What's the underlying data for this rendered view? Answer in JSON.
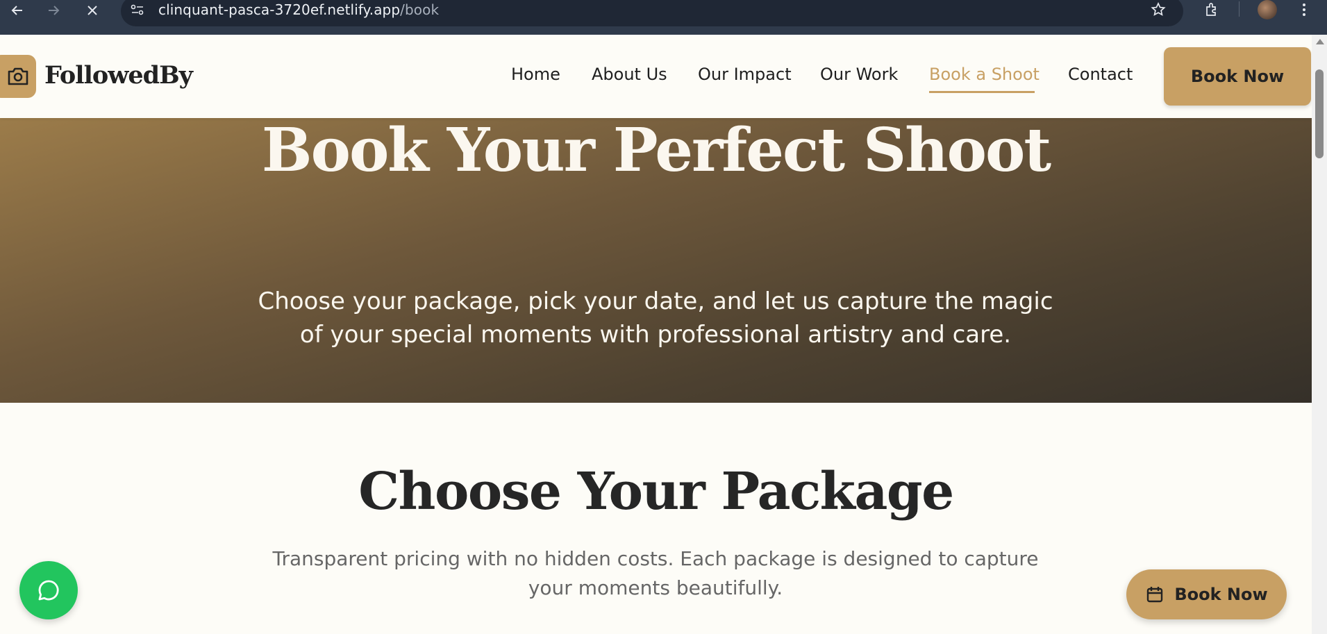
{
  "browser": {
    "url_host": "clinquant-pasca-3720ef.netlify.app",
    "url_path": "/book",
    "icons": [
      "back-arrow-icon",
      "forward-arrow-icon",
      "close-icon",
      "site-info-icon",
      "star-icon",
      "extensions-icon",
      "profile-avatar",
      "kebab-menu-icon"
    ]
  },
  "header": {
    "logo_text": "FollowedBy",
    "logo_icon": "camera-icon",
    "nav": [
      {
        "label": "Home",
        "active": false
      },
      {
        "label": "About Us",
        "active": false
      },
      {
        "label": "Our Impact",
        "active": false
      },
      {
        "label": "Our Work",
        "active": false
      },
      {
        "label": "Book a Shoot",
        "active": true
      },
      {
        "label": "Contact",
        "active": false
      }
    ],
    "cta_label": "Book Now"
  },
  "hero": {
    "title": "Book Your Perfect Shoot",
    "subtitle_line1": "Choose your package, pick your date, and let us capture the magic",
    "subtitle_line2": "of your special moments with professional artistry and care."
  },
  "packages": {
    "title": "Choose Your Package",
    "subtitle_line1": "Transparent pricing with no hidden costs. Each package is designed to capture",
    "subtitle_line2": "your moments beautifully."
  },
  "floating": {
    "chat_icon": "chat-bubble-icon",
    "book_label": "Book Now",
    "book_icon": "calendar-icon"
  },
  "colors": {
    "accent": "#c8a064",
    "chat_green": "#22c55e",
    "hero_start": "#9c7c4a",
    "hero_end": "#353029"
  }
}
